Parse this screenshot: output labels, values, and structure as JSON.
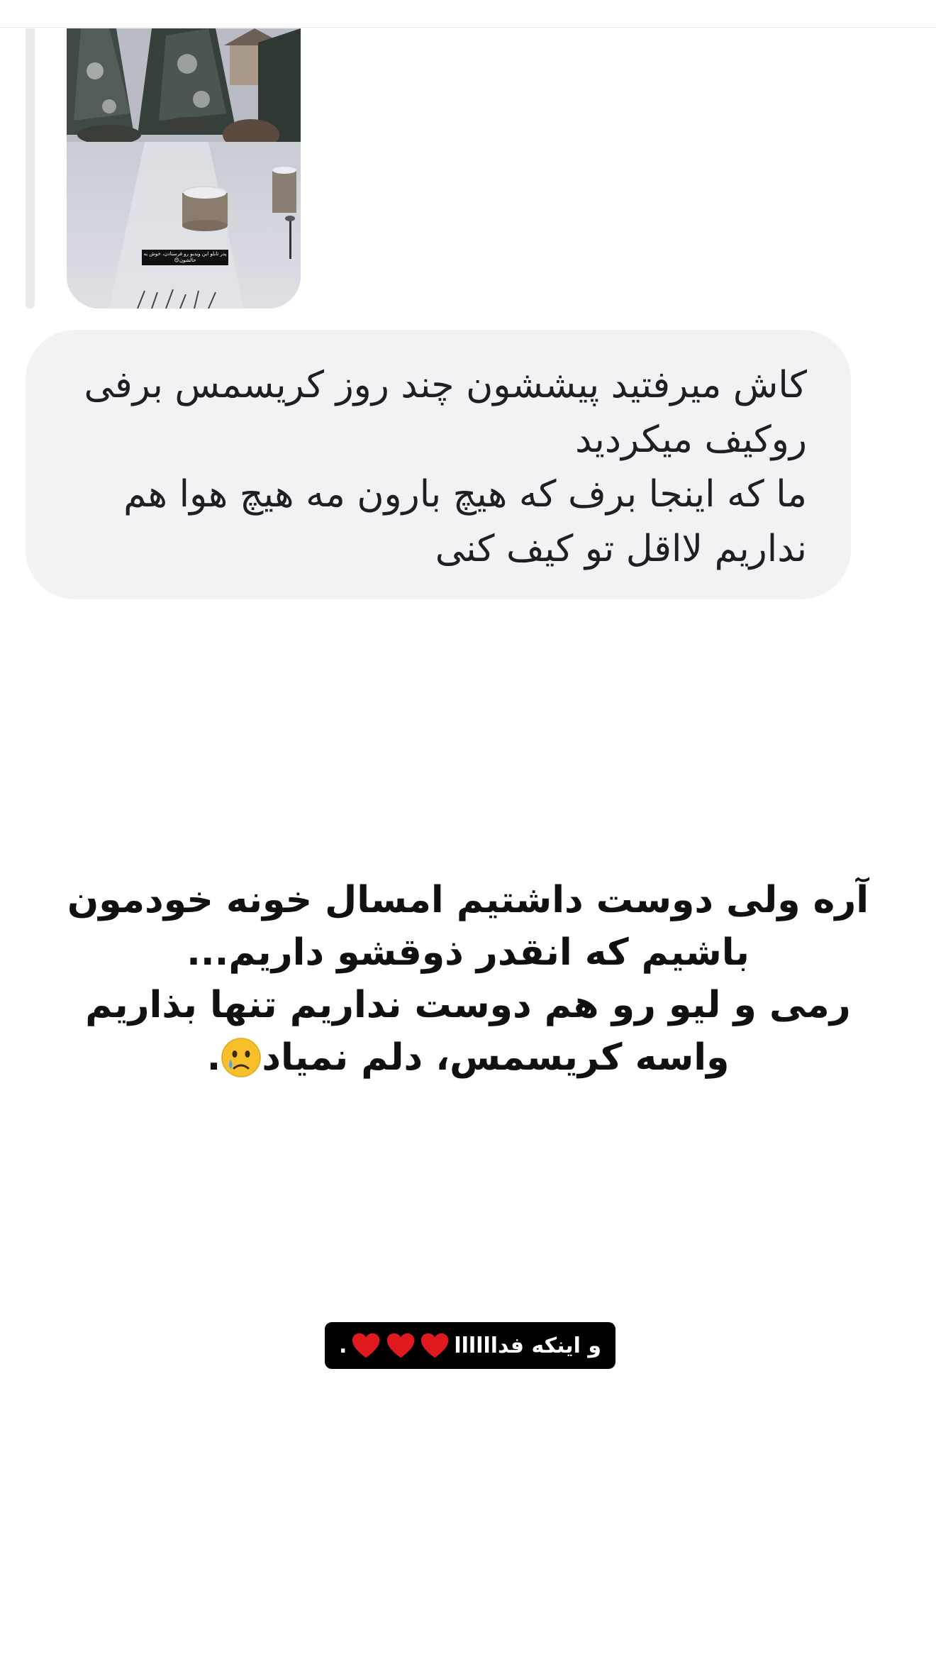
{
  "shared_story": {
    "thumbnail_caption": "پدر تابلو این ویدیو رو فرستادن، خوش به حالشون😊",
    "image_description_icon": "snowy-garden-image"
  },
  "reply_message": {
    "text": "کاش میرفتید پیششون چند روز کریسمس برفی روکیف میکردید\nما که اینجا برف که هیچ بارون مه هیچ هوا هم نداریم لااقل تو کیف کنی"
  },
  "story_text": {
    "lines": "آره ولی دوست داشتیم امسال خونه خودمون باشیم که انقدر ذوقشو داریم...\nرمی و لیو رو هم دوست نداریم تنها بذاریم واسه کریسمس، دلم نمیاد",
    "end_punctuation": ".",
    "emoji_icon": "sad-tear-face-icon"
  },
  "tag_badge": {
    "text": "و اینکه فداااااا",
    "trailing": ".",
    "heart_count": 3,
    "heart_color": "#e0191f",
    "heart_icon": "red-heart-icon"
  },
  "colors": {
    "bubble_bg": "#f1f2f4",
    "text_dark": "#1d1f23",
    "badge_bg": "#000000"
  }
}
